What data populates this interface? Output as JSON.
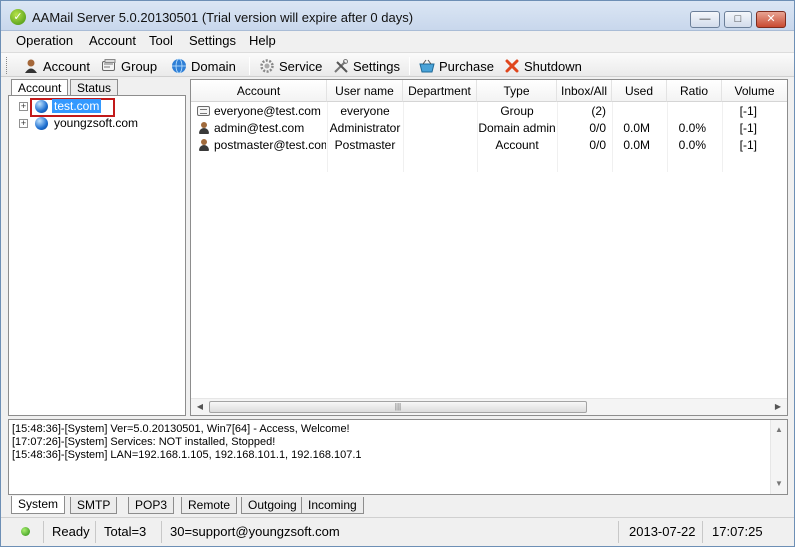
{
  "window": {
    "title": "AAMail Server 5.0.20130501 (Trial version will expire after 0 days)",
    "minimize": "—",
    "maximize": "□",
    "close": "✕"
  },
  "menu": [
    "Operation",
    "Account",
    "Tool",
    "Settings",
    "Help"
  ],
  "toolbar": [
    {
      "label": "Account",
      "icon": "account-icon"
    },
    {
      "label": "Group",
      "icon": "group-icon"
    },
    {
      "label": "Domain",
      "icon": "globe-icon"
    },
    {
      "label": "Service",
      "icon": "service-gear-icon"
    },
    {
      "label": "Settings",
      "icon": "tools-icon"
    },
    {
      "label": "Purchase",
      "icon": "basket-icon"
    },
    {
      "label": "Shutdown",
      "icon": "red-x-icon"
    }
  ],
  "left_tabs": [
    "Account",
    "Status"
  ],
  "tree": [
    {
      "label": "test.com",
      "selected": true
    },
    {
      "label": "youngzsoft.com",
      "selected": false
    }
  ],
  "table": {
    "columns": [
      "Account",
      "User name",
      "Department",
      "Type",
      "Inbox/All",
      "Used",
      "Ratio",
      "Volume"
    ],
    "rows": [
      {
        "icon": "group-mail-icon",
        "account": "everyone@test.com",
        "user": "everyone",
        "dept": "",
        "type": "Group",
        "inbox": "(2)",
        "used": "",
        "ratio": "",
        "volume": "[-1]"
      },
      {
        "icon": "user-icon",
        "account": "admin@test.com",
        "user": "Administrator",
        "dept": "",
        "type": "Domain admin",
        "inbox": "0/0",
        "used": "0.0M",
        "ratio": "0.0%",
        "volume": "[-1]"
      },
      {
        "icon": "user-icon",
        "account": "postmaster@test.com",
        "user": "Postmaster",
        "dept": "",
        "type": "Account",
        "inbox": "0/0",
        "used": "0.0M",
        "ratio": "0.0%",
        "volume": "[-1]"
      }
    ]
  },
  "log": [
    "[15:48:36]-[System] Ver=5.0.20130501, Win7[64] - Access, Welcome!",
    "[17:07:26]-[System] Services: NOT installed, Stopped!",
    "[15:48:36]-[System] LAN=192.168.1.105, 192.168.101.1, 192.168.107.1"
  ],
  "bottom_tabs": [
    "System",
    "SMTP",
    "POP3",
    "Remote",
    "Outgoing",
    "Incoming"
  ],
  "status": {
    "state": "Ready",
    "total": "Total=3",
    "support": "30=support@youngzsoft.com",
    "date": "2013-07-22",
    "time": "17:07:25"
  },
  "colors": {
    "selection": "#3399ff",
    "highlight_outline": "#c21a1a",
    "shutdown": "#e0461d"
  }
}
